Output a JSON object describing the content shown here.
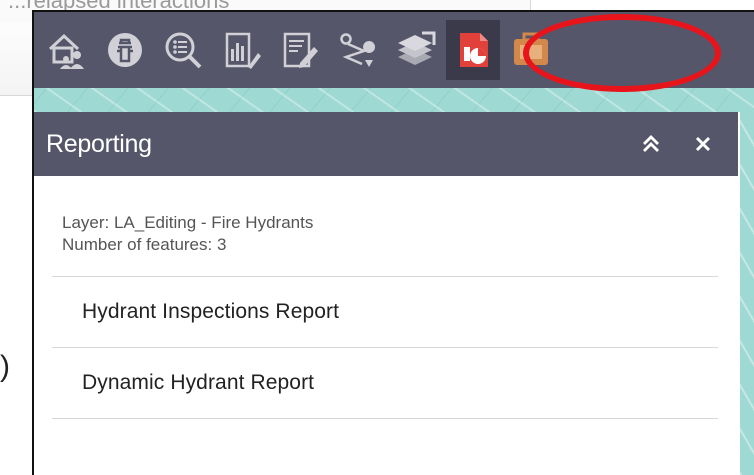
{
  "background": {
    "text_fragment": "...relapsed interactions",
    "paren": ")"
  },
  "toolbar": {
    "tools": [
      {
        "name": "home-people-icon",
        "active": false
      },
      {
        "name": "hydrant-icon",
        "active": false
      },
      {
        "name": "search-list-icon",
        "active": false
      },
      {
        "name": "report-chart-icon",
        "active": false
      },
      {
        "name": "edit-icon",
        "active": false
      },
      {
        "name": "directions-icon",
        "active": false
      },
      {
        "name": "layers-icon",
        "active": false
      },
      {
        "name": "reporting-icon",
        "active": true
      },
      {
        "name": "briefcase-icon",
        "active": false
      }
    ]
  },
  "colors": {
    "toolbar_bg": "#56566a",
    "annotation": "#e8141b",
    "map_bg": "#9fd9d3",
    "reporting_red": "#e2403a"
  },
  "panel": {
    "title": "Reporting",
    "collapse_icon": "double-chevron-up-icon",
    "close_label": "✕",
    "layer_info": "Layer: LA_Editing - Fire Hydrants",
    "feature_count": "Number of features: 3",
    "reports": [
      {
        "label": "Hydrant Inspections Report"
      },
      {
        "label": "Dynamic Hydrant Report"
      }
    ]
  }
}
